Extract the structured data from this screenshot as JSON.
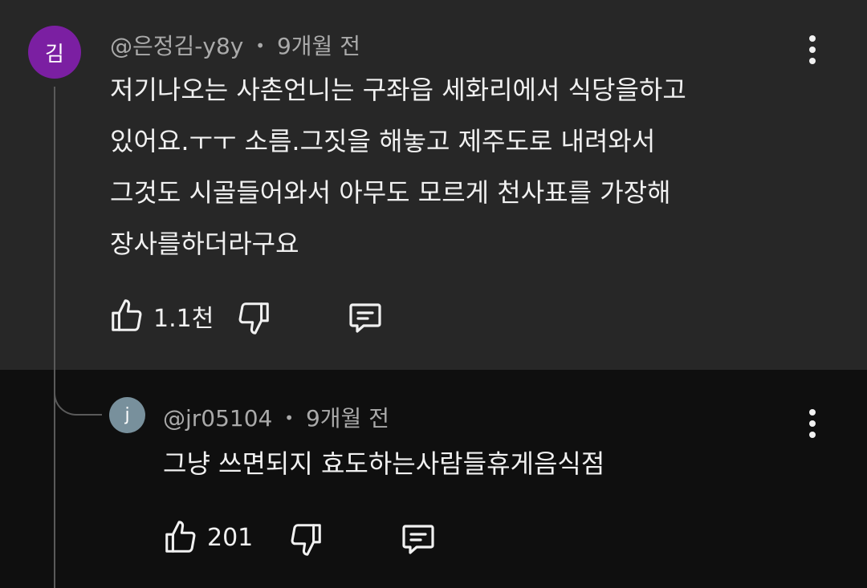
{
  "comment": {
    "avatar_initial": "김",
    "avatar_color": "#7b1fa2",
    "author": "@은정김-y8y",
    "separator": "•",
    "time": "9개월 전",
    "lines": [
      "저기나오는 사촌언니는 구좌읍 세화리에서 식당을하고",
      "있어요.ㅜㅜ 소름.그짓을 해놓고 제주도로 내려와서",
      "그것도 시골들어와서 아무도 모르게 천사표를 가장해",
      "장사를하더라구요"
    ],
    "like_count": "1.1천",
    "icons": {
      "like": "thumb-up-icon",
      "dislike": "thumb-down-icon",
      "reply": "comment-icon",
      "menu": "more-vert-icon"
    }
  },
  "reply": {
    "avatar_initial": "j",
    "avatar_color": "#78909c",
    "author": "@jr05104",
    "separator": "•",
    "time": "9개월 전",
    "text": "그냥 쓰면되지 효도하는사람들휴게음식점",
    "like_count": "201",
    "icons": {
      "like": "thumb-up-icon",
      "dislike": "thumb-down-icon",
      "reply": "comment-icon",
      "menu": "more-vert-icon"
    }
  },
  "colors": {
    "parent_background": "#272727",
    "reply_background": "#0f0f0f",
    "primary_text": "#f1f1f1",
    "secondary_text": "#aaaaaa"
  }
}
